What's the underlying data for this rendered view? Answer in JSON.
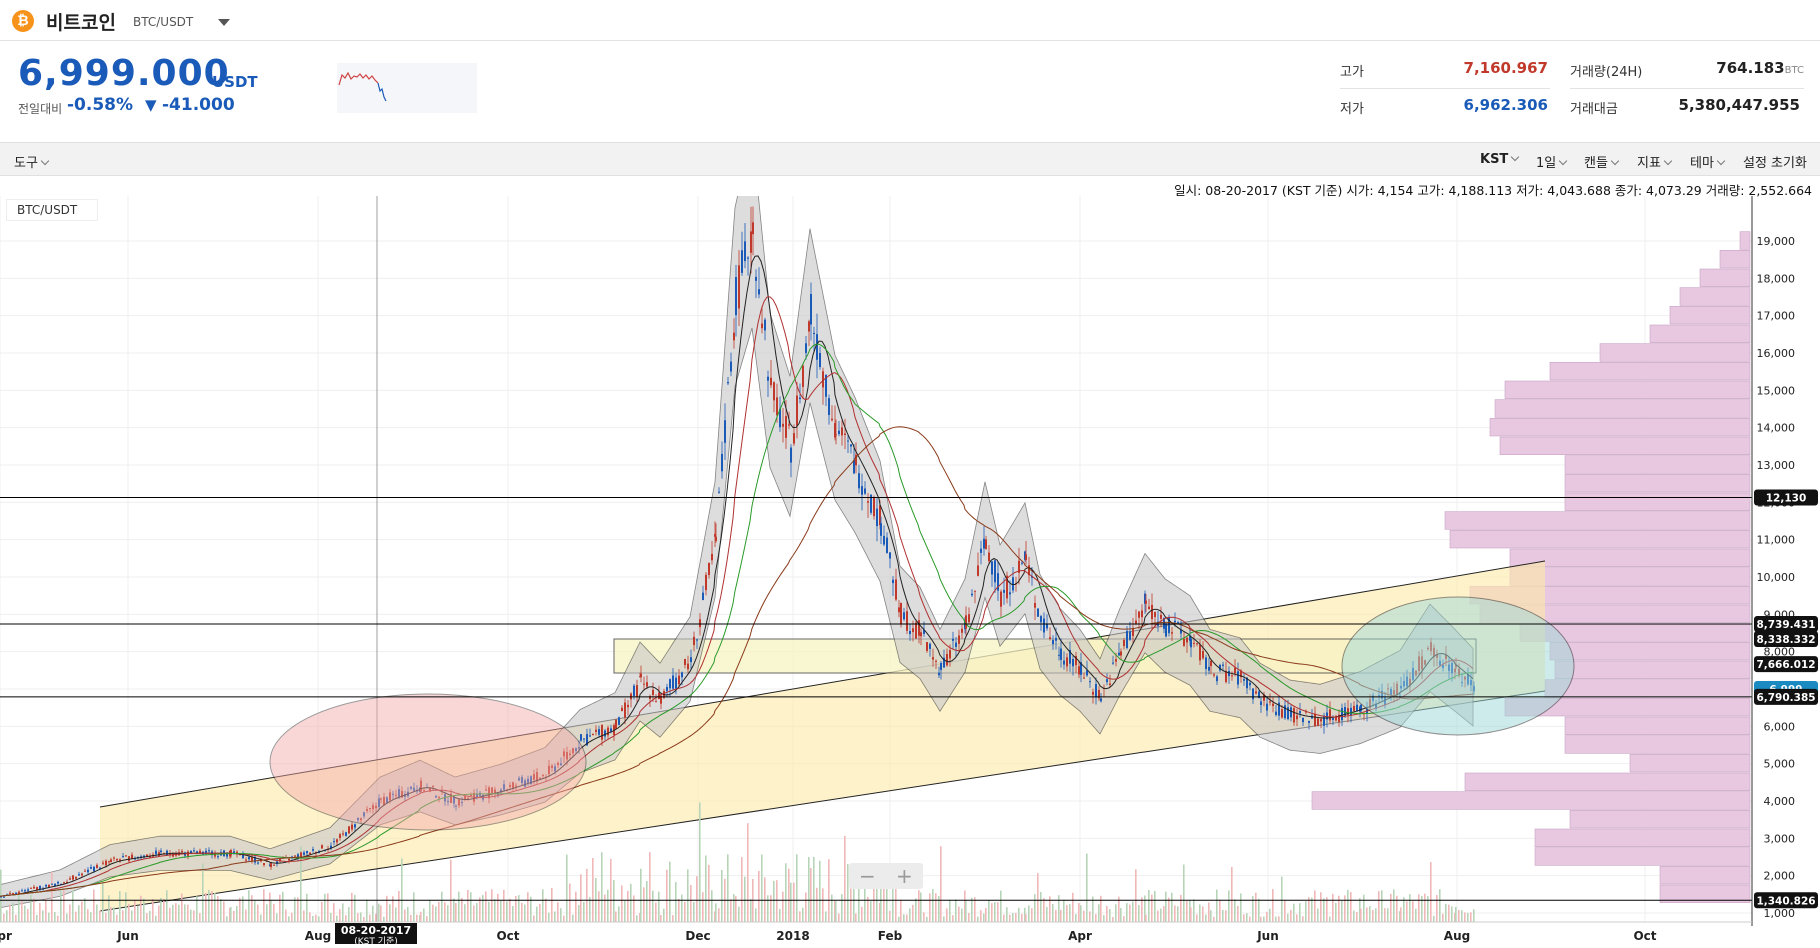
{
  "header": {
    "coin_symbol": "₿",
    "coin_name": "비트코인",
    "pair": "BTC/USDT"
  },
  "price": {
    "value": "6,999.000",
    "unit": "USDT",
    "change_label": "전일대비",
    "change_pct": "-0.58%",
    "change_arrow": "▼",
    "change_abs": "-41.000"
  },
  "stats": {
    "high_label": "고가",
    "high_value": "7,160.967",
    "low_label": "저가",
    "low_value": "6,962.306",
    "volume_label": "거래량(24H)",
    "volume_value": "764.183",
    "volume_unit": "BTC",
    "amount_label": "거래대금",
    "amount_value": "5,380,447.955"
  },
  "toolbar": {
    "tools": "도구",
    "timezone": "KST",
    "interval": "1일",
    "chart_type": "캔들",
    "indicator": "지표",
    "theme": "테마",
    "reset": "설정 초기화"
  },
  "info_line": "일시: 08-20-2017 (KST 기준) 시가: 4,154 고가: 4,188.113 저가: 4,043.688 종가: 4,073.29 거래량: 2,552.664",
  "chart_data": {
    "type": "candlestick",
    "pair": "BTC/USDT",
    "x_ticks": [
      "Apr",
      "Jun",
      "Aug",
      "Oct",
      "Dec",
      "2018",
      "Feb",
      "Apr",
      "Jun",
      "Aug",
      "Oct"
    ],
    "y_ticks": [
      "19,000",
      "18,000",
      "17,000",
      "16,000",
      "15,000",
      "14,000",
      "13,000",
      "12,000",
      "11,000",
      "10,000",
      "9,000",
      "8,000",
      "7,000",
      "6,000",
      "5,000",
      "4,000",
      "3,000",
      "2,000",
      "1,000"
    ],
    "ylim": [
      1000,
      19000
    ],
    "price_badges": {
      "line_12130": "12,130",
      "line_8739": "8,739.431",
      "line_8338": "8,338.332",
      "mark_7666": "7,666.012",
      "current": "6,999",
      "line_6790": "6,790.385",
      "line_1340": "1,340.826"
    },
    "crosshair_date": "08-20-2017",
    "crosshair_sub": "(KST 기준)",
    "colors": {
      "up": "#c0392b",
      "down": "#1a5ab8",
      "bollinger_fill": "#c8c8c8",
      "volume_profile": "#e8c8e0",
      "channel": "#fde9a8",
      "ellipse_red": "#f2a8a8",
      "ellipse_teal": "#9fd9d9"
    }
  }
}
